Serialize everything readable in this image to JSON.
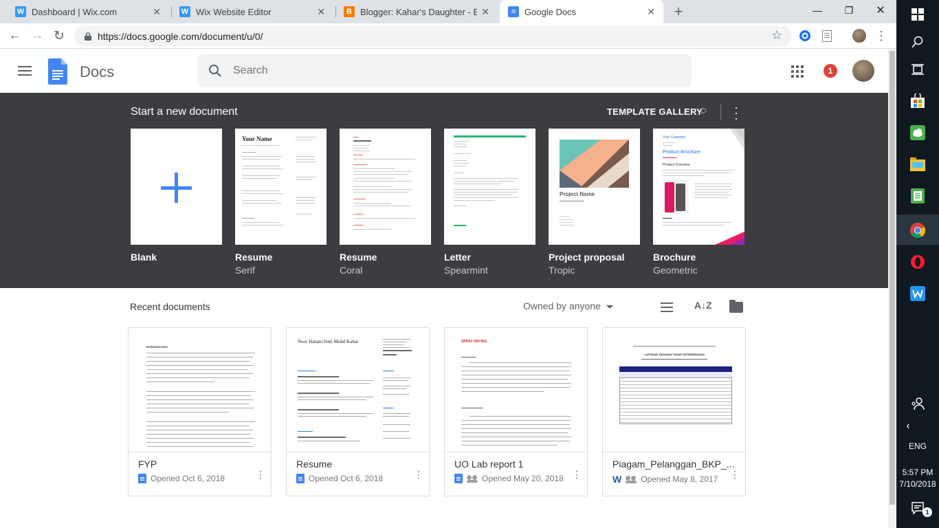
{
  "browser": {
    "tabs": [
      {
        "title": "Dashboard | Wix.com",
        "icon": "wix-icon",
        "active": false
      },
      {
        "title": "Wix Website Editor",
        "icon": "wix-icon",
        "active": false
      },
      {
        "title": "Blogger: Kahar's Daughter - Edit",
        "icon": "blogger-icon",
        "active": false
      },
      {
        "title": "Google Docs",
        "icon": "docs-icon",
        "active": true
      }
    ],
    "new_tab_label": "+",
    "url": "https://docs.google.com/document/u/0/"
  },
  "header": {
    "app_name": "Docs",
    "search_placeholder": "Search",
    "notification_count": "1"
  },
  "gallery": {
    "title": "Start a new document",
    "gallery_button": "TEMPLATE GALLERY",
    "templates": [
      {
        "name": "Blank",
        "sub": ""
      },
      {
        "name": "Resume",
        "sub": "Serif"
      },
      {
        "name": "Resume",
        "sub": "Coral"
      },
      {
        "name": "Letter",
        "sub": "Spearmint"
      },
      {
        "name": "Project proposal",
        "sub": "Tropic"
      },
      {
        "name": "Brochure",
        "sub": "Geometric"
      }
    ],
    "resume_serif_heading": "Your Name",
    "proposal_heading": "Project Name",
    "brochure_company": "Your Company",
    "brochure_heading": "Product Brochure",
    "brochure_overview": "Product Overview"
  },
  "recent": {
    "title": "Recent documents",
    "owner_filter": "Owned by anyone",
    "documents": [
      {
        "name": "FYP",
        "meta": "Opened  Oct 6, 2018",
        "type": "docs",
        "shared": false,
        "thumb_heading": "INTRODUCTION"
      },
      {
        "name": "Resume",
        "meta": "Opened  Oct 6, 2018",
        "type": "docs",
        "shared": false,
        "thumb_heading": "Noor Hanani binti Mohd Kahar"
      },
      {
        "name": "UO Lab report 1",
        "meta": "Opened  May 20, 2018",
        "type": "docs",
        "shared": true,
        "thumb_heading": "SPRAY DRYING"
      },
      {
        "name": "Piagam_Pelanggan_BKP_...",
        "meta": "Opened  May 8, 2017",
        "type": "word",
        "shared": true,
        "thumb_heading": "LAPORAN TAHUNAN TAHAP KETERSEDIAAN"
      }
    ]
  },
  "taskbar": {
    "language": "ENG",
    "time": "5:57 PM",
    "date": "7/10/2018"
  },
  "colors": {
    "gallery_bg": "#3c3c41",
    "docs_blue": "#4285f4",
    "notification_red": "#db4437",
    "taskbar_bg": "#101820"
  }
}
